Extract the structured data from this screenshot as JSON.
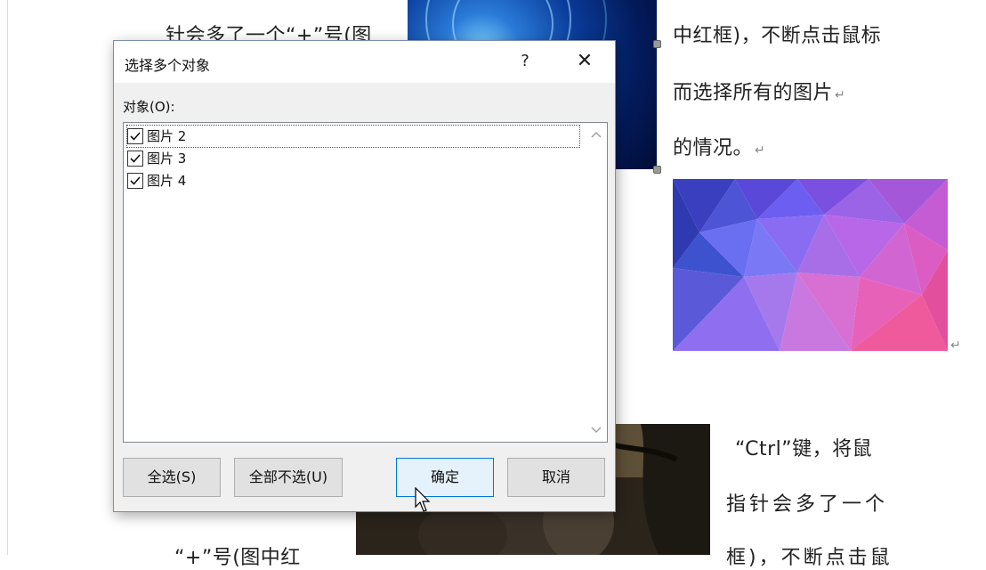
{
  "document": {
    "lines": {
      "top_left": "针会多了一个“+”号(图",
      "right_1": "中红框)，不断点击鼠标",
      "right_2": "而选择所有的图片",
      "right_3": "的情况。",
      "right_4": "“Ctrl”键，将鼠",
      "right_5": "指针会多了一个",
      "right_6": "框)，不断点击鼠",
      "bottom_left": "“+”号(图中红"
    },
    "paragraph_mark": "↵"
  },
  "dialog": {
    "title": "选择多个对象",
    "help_label": "?",
    "close_label": "✕",
    "list_label": "对象(O):",
    "items": [
      {
        "label": "图片 2",
        "checked": true
      },
      {
        "label": "图片 3",
        "checked": true
      },
      {
        "label": "图片 4",
        "checked": true
      }
    ],
    "buttons": {
      "select_all": "全选(S)",
      "deselect_all": "全部不选(U)",
      "ok": "确定",
      "cancel": "取消"
    }
  },
  "colors": {
    "accent": "#0078d7",
    "dialog_bg": "#f0f0f0"
  },
  "icons": [
    "checkbox-checked-icon",
    "chevron-up-icon",
    "chevron-down-icon",
    "close-icon",
    "help-icon",
    "mouse-cursor-icon"
  ]
}
